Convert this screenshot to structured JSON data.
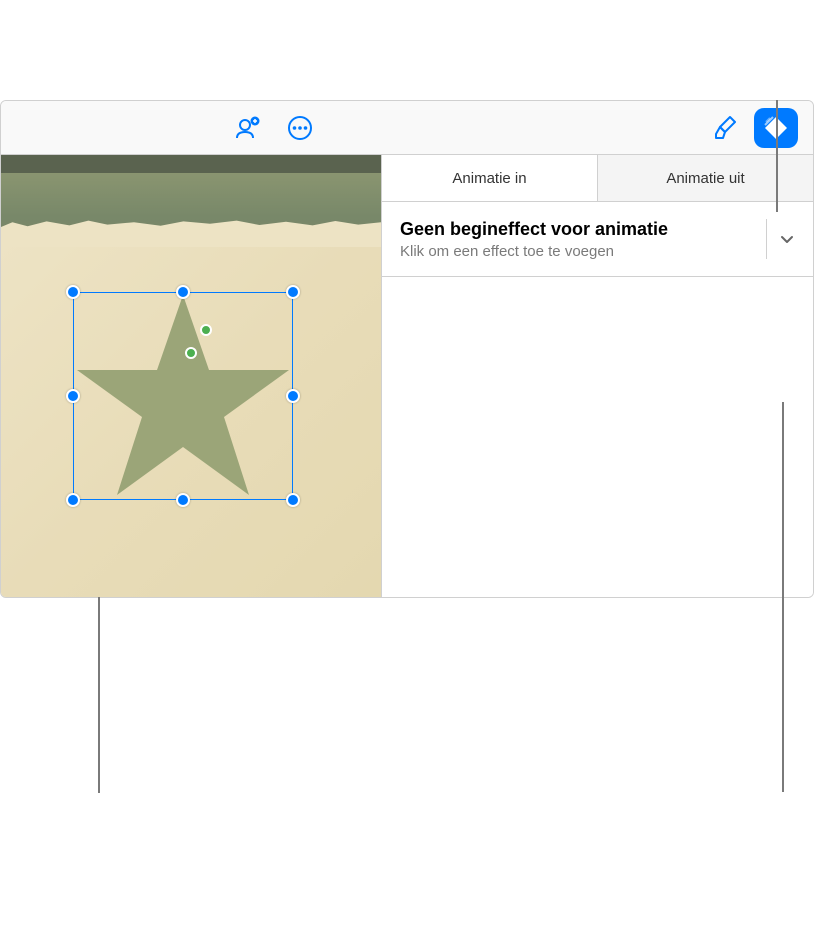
{
  "tabs": {
    "animate_in": "Animatie in",
    "animate_out": "Animatie uit"
  },
  "effect": {
    "title": "Geen begineffect voor animatie",
    "subtitle": "Klik om een effect toe te voegen"
  },
  "colors": {
    "primary": "#007aff",
    "star": "#9ba578"
  },
  "icons": {
    "collaborate": "collaborate-icon",
    "more": "more-icon",
    "format": "format-icon",
    "animate": "animate-icon"
  }
}
